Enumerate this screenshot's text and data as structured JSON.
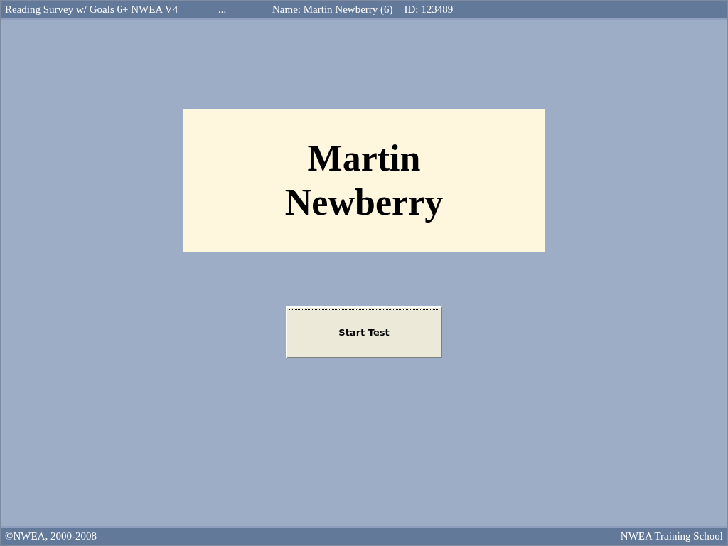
{
  "header": {
    "test_name": "Reading Survey w/ Goals 6+ NWEA V4",
    "ellipsis": "...",
    "student": "Name: Martin Newberry (6)",
    "id": "ID: 123489"
  },
  "name_card": {
    "lines": [
      "Martin",
      "Newberry"
    ]
  },
  "start_button": {
    "label": "Start Test",
    "focused": true
  },
  "footer": {
    "copyright": "©NWEA, 2000-2008",
    "school": "NWEA Training School"
  }
}
